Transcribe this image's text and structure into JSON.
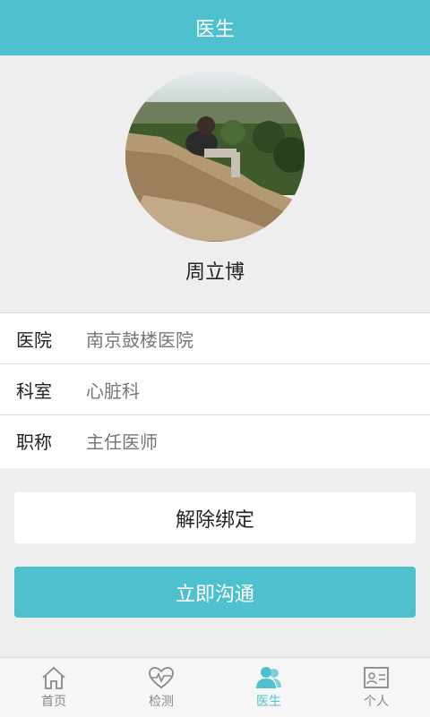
{
  "header": {
    "title": "医生"
  },
  "doctor": {
    "name": "周立博"
  },
  "info": [
    {
      "label": "医院",
      "value": "南京鼓楼医院"
    },
    {
      "label": "科室",
      "value": "心脏科"
    },
    {
      "label": "职称",
      "value": "主任医师"
    }
  ],
  "buttons": {
    "unbind": "解除绑定",
    "chat": "立即沟通"
  },
  "tabs": [
    {
      "label": "首页",
      "icon": "home-icon"
    },
    {
      "label": "检测",
      "icon": "heart-pulse-icon"
    },
    {
      "label": "医生",
      "icon": "doctor-icon"
    },
    {
      "label": "个人",
      "icon": "id-card-icon"
    }
  ],
  "colors": {
    "accent": "#4fc0ce",
    "background": "#eeeeee"
  }
}
